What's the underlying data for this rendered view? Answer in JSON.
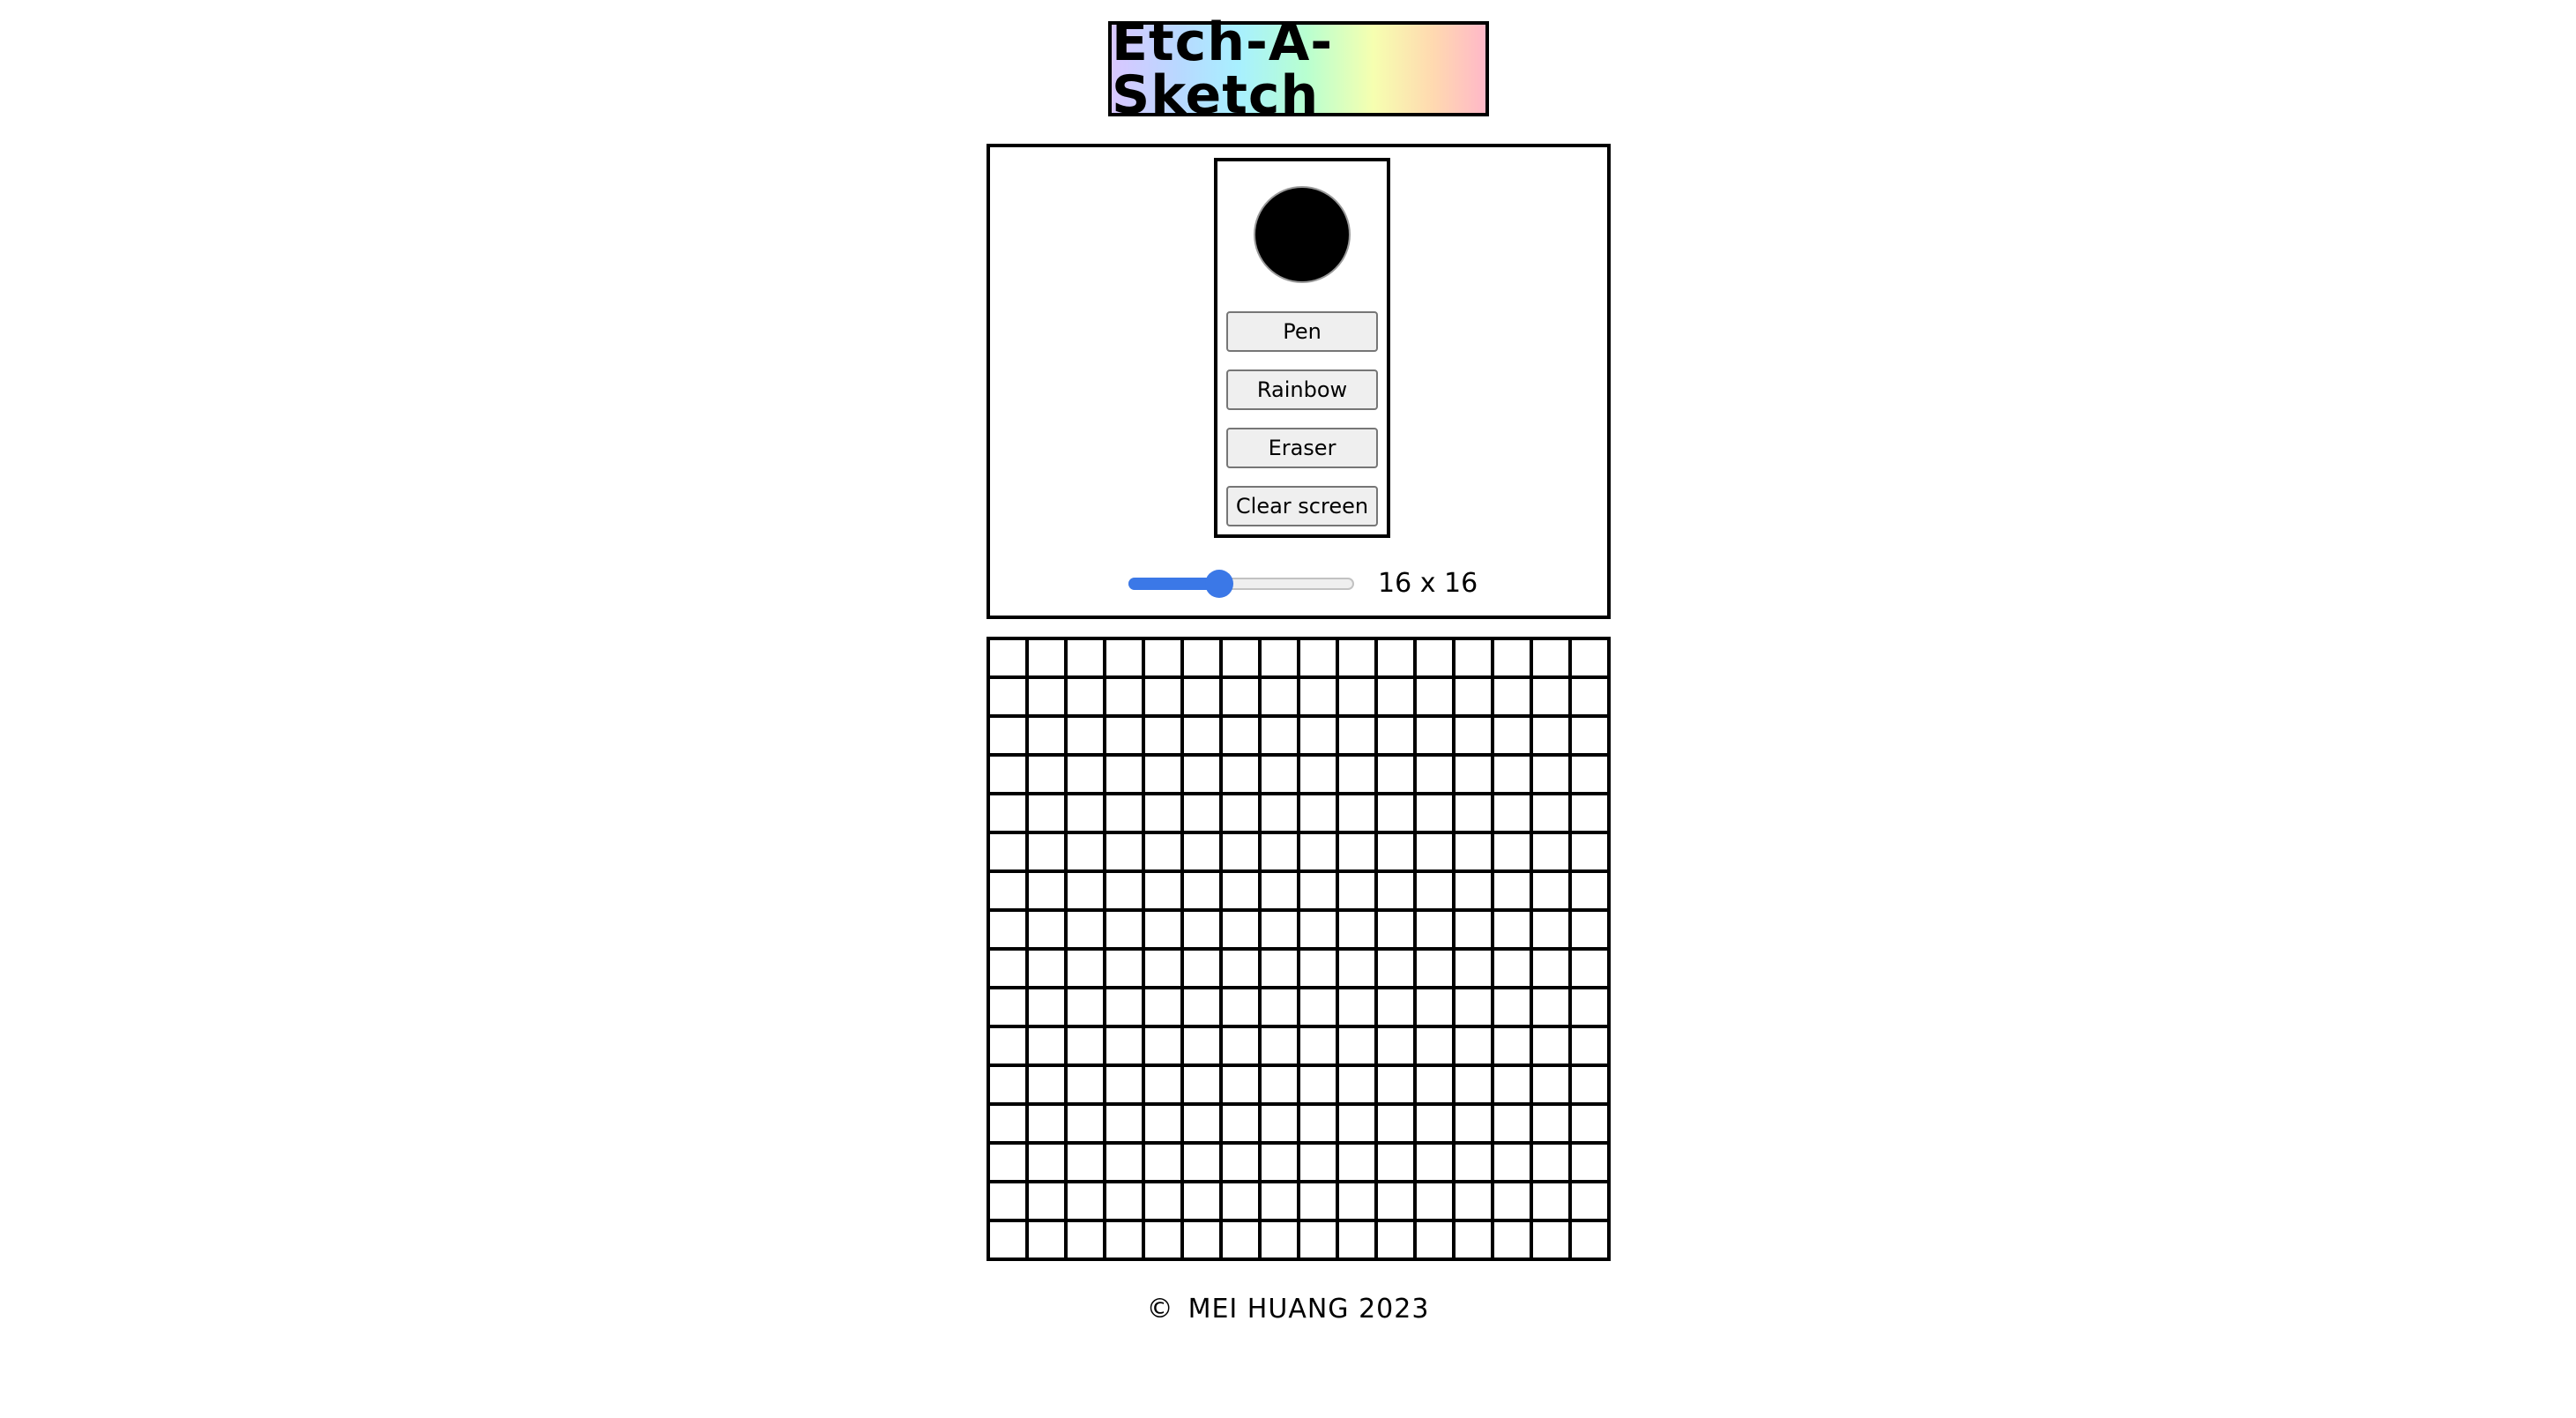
{
  "title": "Etch-A-Sketch",
  "tools": {
    "current_color": "#000000",
    "pen_label": "Pen",
    "rainbow_label": "Rainbow",
    "eraser_label": "Eraser",
    "clear_label": "Clear screen"
  },
  "slider": {
    "min": 1,
    "max": 100,
    "value": 16,
    "size_label": "16 x 16",
    "accent_color": "#3b78e7"
  },
  "grid": {
    "rows": 16,
    "cols": 16,
    "cell_color": "#ffffff",
    "line_color": "#000000"
  },
  "footer": {
    "copyright_symbol": "©",
    "text": "MEI HUANG 2023"
  }
}
